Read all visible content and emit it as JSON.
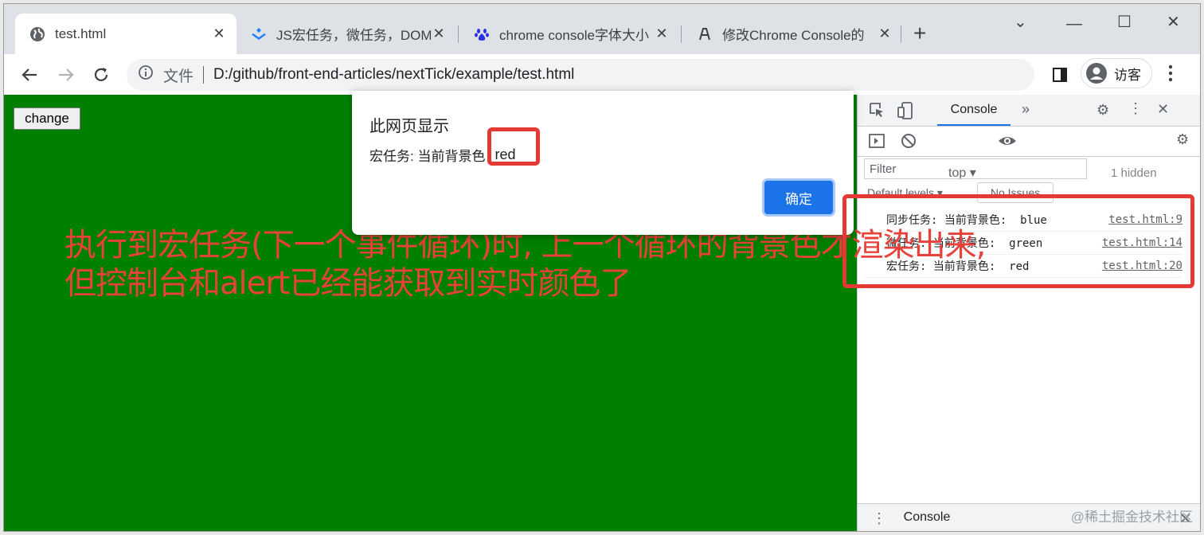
{
  "tabs": [
    {
      "title": "test.html",
      "icon": "globe-icon"
    },
    {
      "title": "JS宏任务，微任务，DOM",
      "icon": "juejin-icon"
    },
    {
      "title": "chrome console字体大小",
      "icon": "baidu-paw-icon"
    },
    {
      "title": "修改Chrome Console的",
      "icon": "pen-icon"
    }
  ],
  "address": {
    "scheme_label": "文件",
    "url": "D:/github/front-end-articles/nextTick/example/test.html"
  },
  "profile": {
    "label": "访客"
  },
  "page": {
    "change_button": "change",
    "background": "#008000",
    "annotation_line1": "执行到宏任务(下一个事件循环)时, 上一个循环的背景色才渲染出来,",
    "annotation_line2": "但控制台和alert已经能获取到实时颜色了"
  },
  "alert": {
    "title": "此网页显示",
    "message": "宏任务: 当前背景色",
    "value": "red",
    "ok_label": "确定"
  },
  "devtools": {
    "console_tab": "Console",
    "context": "top",
    "hidden": "1 hidden",
    "filter_placeholder": "Filter",
    "levels": "Default levels ▾",
    "issues": "No Issues",
    "drawer_tab": "Console",
    "messages": [
      {
        "text": "同步任务: 当前背景色:  blue",
        "source": "test.html:9"
      },
      {
        "text": "微任务: 当前背景色:  green",
        "source": "test.html:14"
      },
      {
        "text": "宏任务: 当前背景色:  red  ",
        "source": "test.html:20"
      }
    ]
  },
  "watermark": "@稀土掘金技术社区",
  "colors": {
    "accent": "#1a73e8",
    "highlight": "#e53935",
    "annotation": "#e8413a"
  }
}
